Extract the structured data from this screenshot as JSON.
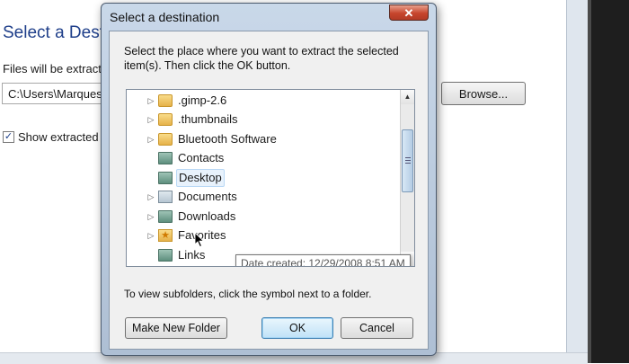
{
  "background": {
    "title": "Select a Destin",
    "files_label": "Files will be extracte",
    "path_value": "C:\\Users\\Marques",
    "browse_label": "Browse...",
    "show_extracted_label": "Show extracted f",
    "show_extracted_checked": true
  },
  "dialog": {
    "title": "Select a destination",
    "close_glyph": "✕",
    "instructions": "Select the place where you want to extract the selected item(s).  Then click the OK button.",
    "tree_items": [
      {
        "label": ".gimp-2.6",
        "icon": "folder-icon",
        "expandable": true
      },
      {
        "label": ".thumbnails",
        "icon": "folder-icon",
        "expandable": true
      },
      {
        "label": "Bluetooth Software",
        "icon": "folder-icon",
        "expandable": true
      },
      {
        "label": "Contacts",
        "icon": "contacts-folder-icon",
        "expandable": false
      },
      {
        "label": "Desktop",
        "icon": "desktop-folder-icon",
        "expandable": false
      },
      {
        "label": "Documents",
        "icon": "documents-folder-icon",
        "expandable": true
      },
      {
        "label": "Downloads",
        "icon": "downloads-folder-icon",
        "expandable": true
      },
      {
        "label": "Favorites",
        "icon": "favorites-folder-icon",
        "expandable": true
      },
      {
        "label": "Links",
        "icon": "links-folder-icon",
        "expandable": false
      }
    ],
    "tooltip": "Date created: 12/29/2008 8:51 AM",
    "hint": "To view subfolders, click the symbol next to a folder.",
    "buttons": {
      "new_folder": "Make New Folder",
      "ok": "OK",
      "cancel": "Cancel"
    }
  },
  "colors": {
    "accent": "#1f3f8a",
    "dialog_frame": "#aebfd4",
    "close_button": "#c7452d"
  }
}
